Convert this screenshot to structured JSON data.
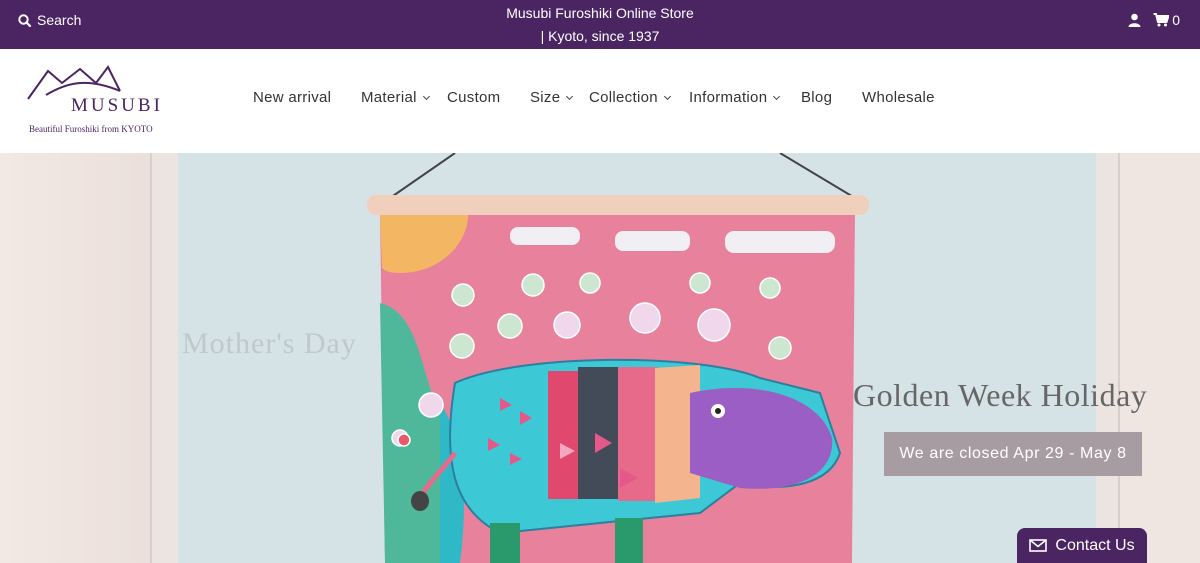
{
  "topbar": {
    "search_label": "Search",
    "store_line1": "Musubi Furoshiki Online Store",
    "store_line2": "| Kyoto, since 1937",
    "cart_count": "0"
  },
  "logo": {
    "wordmark": "MUSUBI",
    "tagline": "Beautiful Furoshiki from KYOTO"
  },
  "nav": {
    "items": [
      {
        "label": "New arrival",
        "dropdown": false
      },
      {
        "label": "Material",
        "dropdown": true
      },
      {
        "label": "Custom",
        "dropdown": false
      },
      {
        "label": "Size",
        "dropdown": true
      },
      {
        "label": "Collection",
        "dropdown": true
      },
      {
        "label": "Information",
        "dropdown": true
      },
      {
        "label": "Blog",
        "dropdown": false
      },
      {
        "label": "Wholesale",
        "dropdown": false
      }
    ]
  },
  "hero": {
    "faded_title": "Mother's Day",
    "title": "Golden Week Holiday",
    "button_label": "We are closed Apr 29 - May 8"
  },
  "contact": {
    "label": "Contact Us"
  },
  "colors": {
    "brand": "#4b2462",
    "button": "#a89ca3"
  }
}
